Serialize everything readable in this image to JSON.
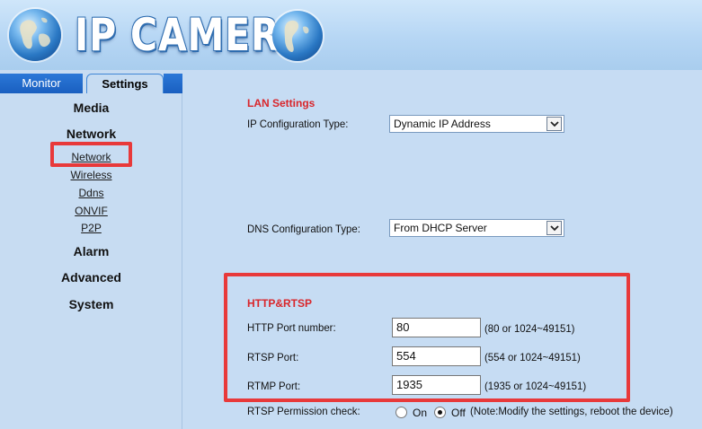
{
  "header": {
    "title": "IP CAMERA",
    "globe_icon": "globe-icon"
  },
  "tabs": {
    "monitor": "Monitor",
    "settings": "Settings"
  },
  "sidebar": {
    "media": "Media",
    "network": "Network",
    "network_subitems": [
      "Network",
      "Wireless",
      "Ddns",
      "ONVIF",
      "P2P"
    ],
    "alarm": "Alarm",
    "advanced": "Advanced",
    "system": "System"
  },
  "lan": {
    "title": "LAN Settings",
    "ip_config_label": "IP Configuration Type:",
    "ip_config_value": "Dynamic IP Address",
    "dns_config_label": "DNS Configuration Type:",
    "dns_config_value": "From DHCP Server"
  },
  "http_rtsp": {
    "title": "HTTP&RTSP",
    "http_port_label": "HTTP Port number:",
    "http_port_value": "80",
    "http_port_hint": "(80 or 1024~49151)",
    "rtsp_port_label": "RTSP Port:",
    "rtsp_port_value": "554",
    "rtsp_port_hint": "(554 or 1024~49151)",
    "rtmp_port_label": "RTMP Port:",
    "rtmp_port_value": "1935",
    "rtmp_port_hint": "(1935 or 1024~49151)",
    "rtsp_permission_label": "RTSP Permission check:",
    "rtsp_on_label": "On",
    "rtsp_off_label": "Off",
    "rtsp_note": "(Note:Modify the settings, reboot the device)",
    "rtsp_permission_selected": "Off"
  },
  "colors": {
    "accent_red": "#d9262b",
    "highlight_box": "#e8393a",
    "tab_blue": "#1a5fc0",
    "panel_bg": "#c6dcf3"
  }
}
